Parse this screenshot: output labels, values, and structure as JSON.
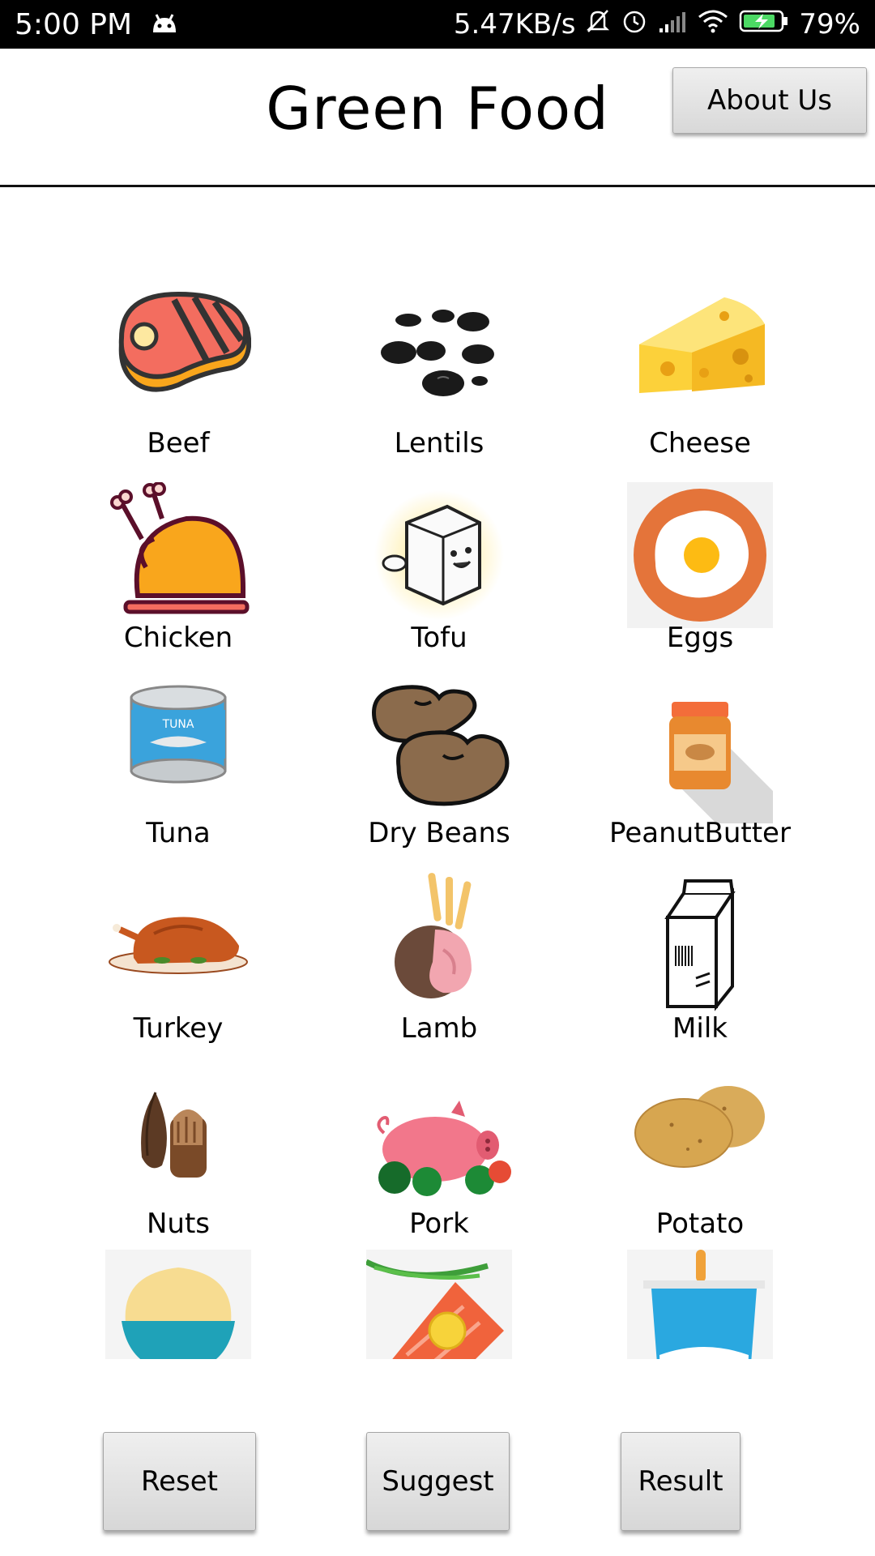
{
  "status_bar": {
    "time": "5:00 PM",
    "network_speed": "5.47KB/s",
    "battery": "79%",
    "icons": [
      "android-icon",
      "mute-icon",
      "alarm-icon",
      "signal-icon",
      "wifi-icon",
      "battery-icon"
    ]
  },
  "header": {
    "title": "Green Food",
    "about_label": "About Us"
  },
  "foods": [
    {
      "label": "Beef",
      "icon": "beef-icon"
    },
    {
      "label": "Lentils",
      "icon": "lentils-icon"
    },
    {
      "label": "Cheese",
      "icon": "cheese-icon"
    },
    {
      "label": "Chicken",
      "icon": "chicken-icon"
    },
    {
      "label": "Tofu",
      "icon": "tofu-icon"
    },
    {
      "label": "Eggs",
      "icon": "egg-icon"
    },
    {
      "label": "Tuna",
      "icon": "tuna-can-icon"
    },
    {
      "label": "Dry Beans",
      "icon": "dry-beans-icon"
    },
    {
      "label": "PeanutButter",
      "icon": "peanut-butter-icon"
    },
    {
      "label": "Turkey",
      "icon": "turkey-icon"
    },
    {
      "label": "Lamb",
      "icon": "lamb-icon"
    },
    {
      "label": "Milk",
      "icon": "milk-carton-icon"
    },
    {
      "label": "Nuts",
      "icon": "nuts-icon"
    },
    {
      "label": "Pork",
      "icon": "pig-icon"
    },
    {
      "label": "Potato",
      "icon": "potato-icon"
    }
  ],
  "partial_items": [
    {
      "icon": "rice-bowl-icon"
    },
    {
      "icon": "salmon-icon"
    },
    {
      "icon": "yogurt-icon"
    }
  ],
  "buttons": {
    "reset": "Reset",
    "suggest": "Suggest",
    "result": "Result"
  }
}
